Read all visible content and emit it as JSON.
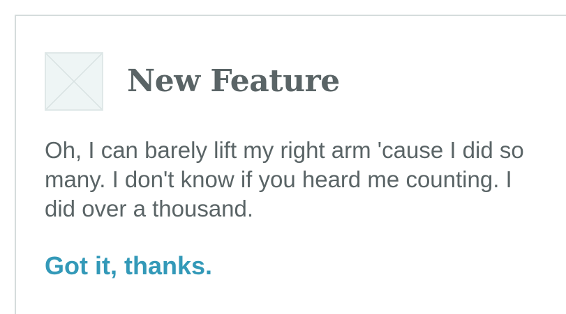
{
  "feature_card": {
    "title": "New Feature",
    "message": "Oh, I can barely lift my right arm 'cause I did so many. I don't know if you heard me counting. I did over a thousand.",
    "dismiss_label": "Got it, thanks.",
    "thumbnail_icon": "image-placeholder-icon"
  },
  "colors": {
    "text": "#5a6466",
    "link": "#3399b8",
    "border": "#d5dcdc",
    "placeholder_bg": "#eef5f5"
  }
}
